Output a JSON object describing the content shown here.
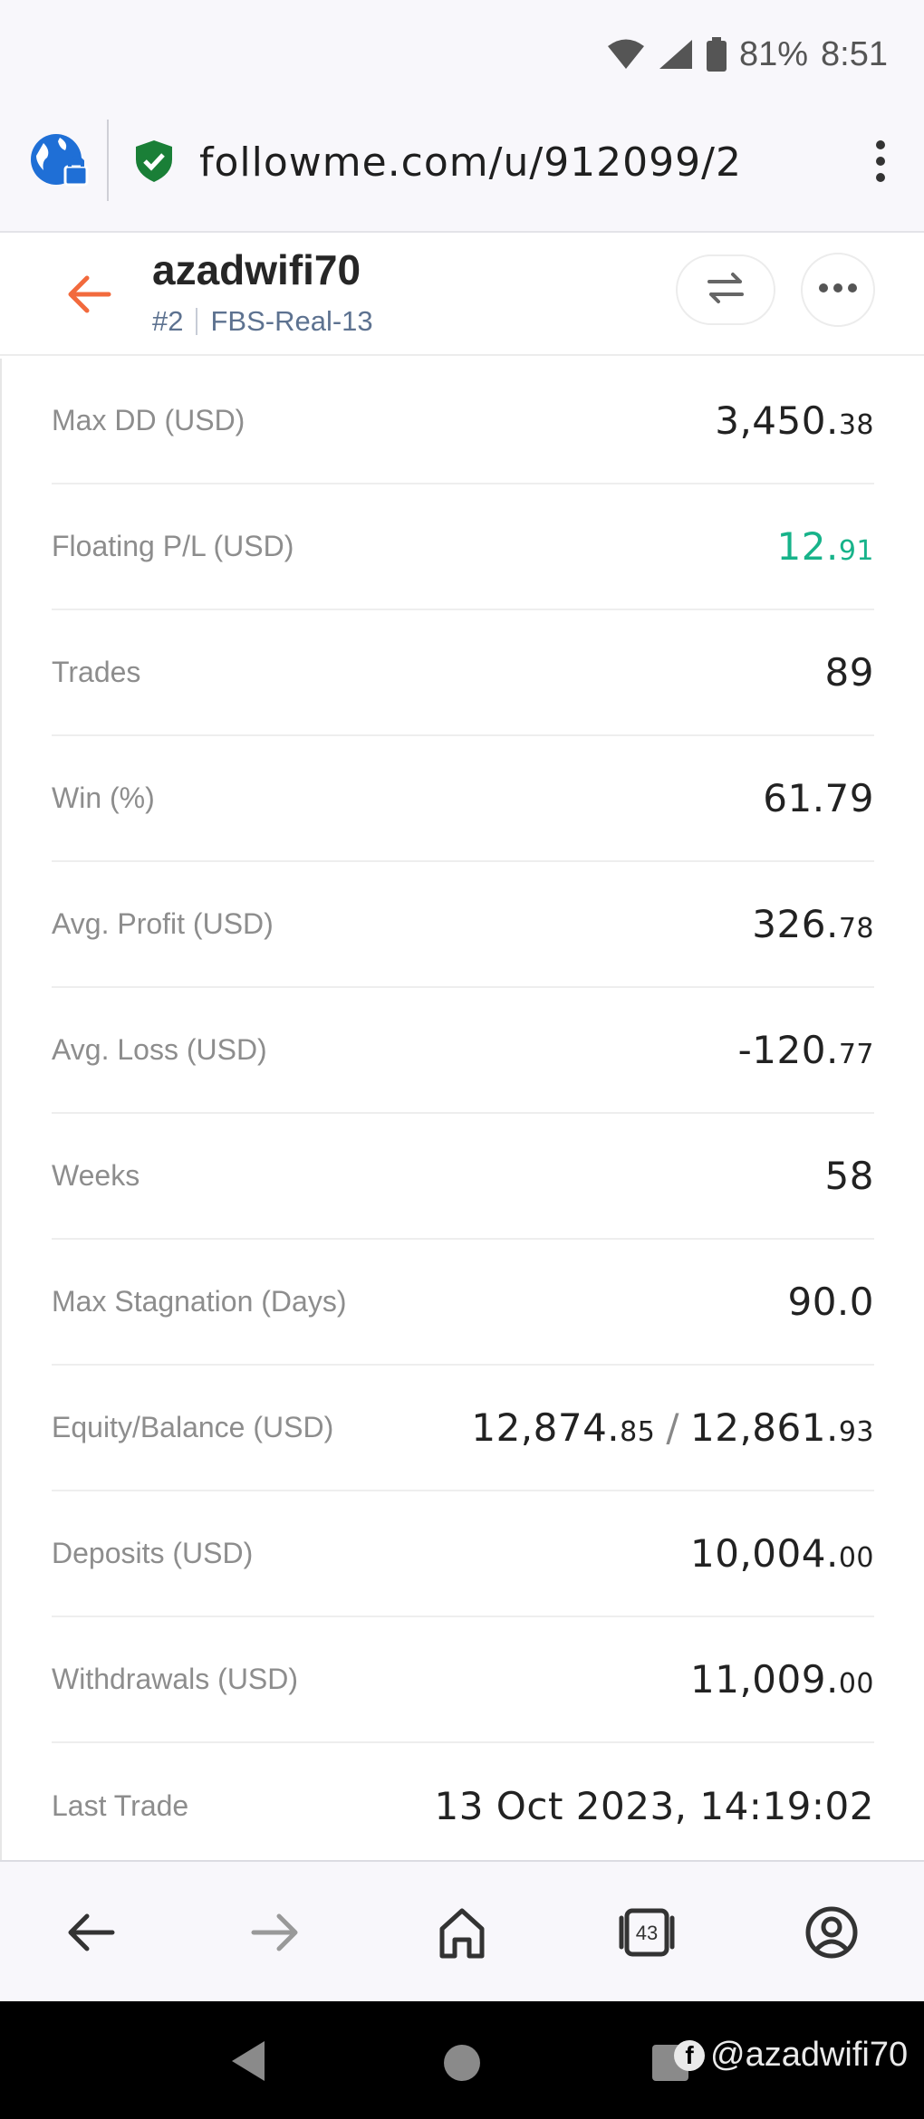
{
  "status_bar": {
    "battery": "81%",
    "time": "8:51"
  },
  "browser": {
    "url": "followme.com/u/912099/2"
  },
  "header": {
    "username": "azadwifi70",
    "rank": "#2",
    "account": "FBS-Real-13"
  },
  "stats": {
    "max_dd": {
      "label": "Max DD (USD)",
      "int": "3,450.",
      "dec": "38"
    },
    "floating_pl": {
      "label": "Floating P/L (USD)",
      "int": "12.",
      "dec": "91"
    },
    "trades": {
      "label": "Trades",
      "value": "89"
    },
    "win": {
      "label": "Win (%)",
      "value": "61.79"
    },
    "avg_profit": {
      "label": "Avg. Profit (USD)",
      "int": "326.",
      "dec": "78"
    },
    "avg_loss": {
      "label": "Avg. Loss (USD)",
      "int": "-120.",
      "dec": "77"
    },
    "weeks": {
      "label": "Weeks",
      "value": "58"
    },
    "max_stagnation": {
      "label": "Max Stagnation (Days)",
      "value": "90.0"
    },
    "equity_balance": {
      "label": "Equity/Balance (USD)",
      "eq_int": "12,874.",
      "eq_dec": "85",
      "bal_int": "12,861.",
      "bal_dec": "93"
    },
    "deposits": {
      "label": "Deposits (USD)",
      "int": "10,004.",
      "dec": "00"
    },
    "withdrawals": {
      "label": "Withdrawals (USD)",
      "int": "11,009.",
      "dec": "00"
    },
    "last_trade": {
      "label": "Last Trade",
      "value": "13 Oct 2023, 14:19:02"
    }
  },
  "bottom_nav": {
    "tab_count": "43"
  },
  "watermark": {
    "text": "@azadwifi70"
  },
  "colors": {
    "accent": "#f26a3d",
    "positive": "#17b38a",
    "shield": "#1a7f37",
    "globe": "#1f6fd6"
  },
  "icons": [
    "wifi-icon",
    "signal-icon",
    "battery-icon",
    "globe-lock-icon",
    "shield-check-icon",
    "kebab-menu-icon",
    "back-arrow-icon",
    "swap-icon",
    "more-icon",
    "nav-back-icon",
    "nav-forward-icon",
    "home-icon",
    "tabs-icon",
    "account-icon",
    "facebook-icon"
  ]
}
